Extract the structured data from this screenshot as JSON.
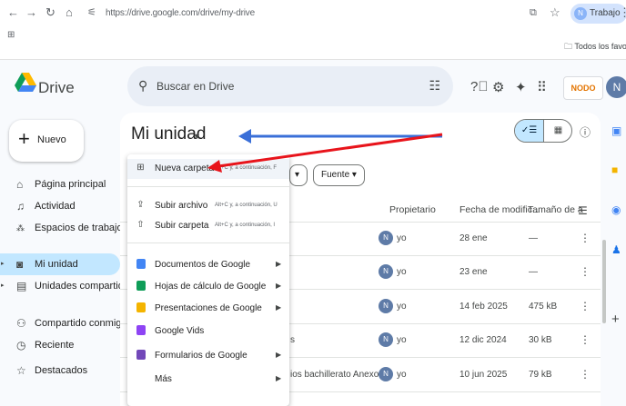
{
  "browser": {
    "url": "https://drive.google.com/drive/my-drive",
    "profile_name": "Trabajo",
    "profile_initial": "N",
    "bookmarks_all": "Todos los favoritos"
  },
  "header": {
    "app_name": "Drive",
    "search_placeholder": "Buscar en Drive",
    "org_logo_text": "NODO",
    "avatar_initial": "N"
  },
  "sidebar": {
    "new_label": "Nuevo",
    "items": [
      {
        "label": "Página principal"
      },
      {
        "label": "Actividad"
      },
      {
        "label": "Espacios de trabajo"
      },
      {
        "label": "Mi unidad"
      },
      {
        "label": "Unidades compartidas"
      },
      {
        "label": "Compartido conmigo"
      },
      {
        "label": "Reciente"
      },
      {
        "label": "Destacados"
      }
    ]
  },
  "main": {
    "title": "Mi unidad",
    "filters": {
      "source": "Fuente"
    },
    "columns": {
      "owner": "Propietario",
      "modified": "Fecha de modific...",
      "size": "Tamaño de a"
    },
    "rows": [
      {
        "name": "",
        "owner": "yo",
        "modified": "28 ene",
        "size": "—"
      },
      {
        "name": "",
        "owner": "yo",
        "modified": "23 ene",
        "size": "—"
      },
      {
        "name": "",
        "owner": "yo",
        "modified": "14 feb 2025",
        "size": "475 kB"
      },
      {
        "name": "s",
        "owner": "yo",
        "modified": "12 dic 2024",
        "size": "30 kB"
      },
      {
        "name": "ios bachillerato Anexo I...",
        "owner": "yo",
        "modified": "10 jun 2025",
        "size": "79 kB"
      }
    ]
  },
  "menu": {
    "items": [
      {
        "label": "Nueva carpeta",
        "shortcut": "Alt+C y, a continuación, F"
      },
      {
        "label": "Subir archivo",
        "shortcut": "Alt+C y, a continuación, U"
      },
      {
        "label": "Subir carpeta",
        "shortcut": "Alt+C y, a continuación, I"
      },
      {
        "label": "Documentos de Google"
      },
      {
        "label": "Hojas de cálculo de Google"
      },
      {
        "label": "Presentaciones de Google"
      },
      {
        "label": "Google Vids"
      },
      {
        "label": "Formularios de Google"
      },
      {
        "label": "Más"
      }
    ]
  },
  "colors": {
    "accent": "#c2e7ff",
    "arrow_blue": "#3a6fd8",
    "arrow_red": "#e8141b",
    "docs": "#4285f4",
    "sheets": "#0f9d58",
    "slides": "#f4b400",
    "vids": "#8e44f4",
    "forms": "#7248b9"
  }
}
